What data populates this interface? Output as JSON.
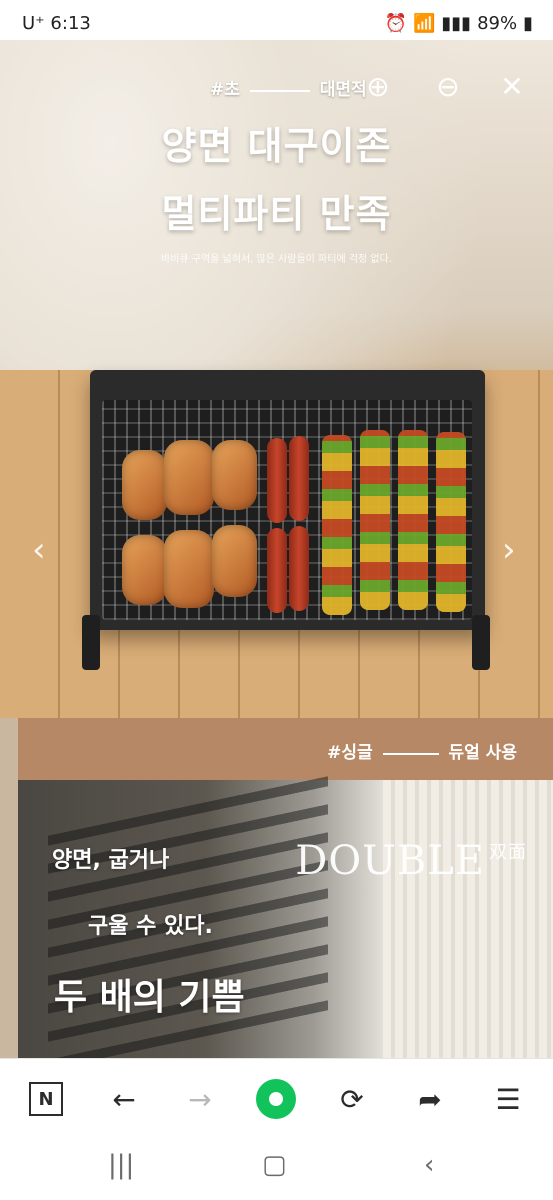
{
  "status_bar": {
    "time": "6:13",
    "carrier": "U⁺",
    "battery": "89%"
  },
  "viewer": {
    "buttons": {
      "zoom_in": "zoom-in-icon",
      "zoom_out": "zoom-out-icon",
      "close": "close-icon"
    },
    "nav_arrows": {
      "prev": "chevron-left-icon",
      "next": "chevron-right-icon"
    },
    "section1": {
      "hashtag_prefix": "#초",
      "hashtag_suffix": "대면적",
      "title_line1": "양면 대구이존",
      "title_line2": "멀티파티 만족",
      "subtitle": "바비큐 구역을 넓혀서, 많은 사람들이 파티에 걱정 없다."
    },
    "section2": {
      "hashtag_prefix": "#싱글",
      "hashtag_suffix": "듀얼 사용",
      "brand": "DOUBLE",
      "brand_cjk": "双面",
      "line1": "양면, 굽거나",
      "line2": "구울 수 있다.",
      "line3": "두 배의 기쁨"
    }
  },
  "browser_toolbar": {
    "items": [
      "N-logo-icon",
      "back-icon",
      "forward-icon",
      "home-green-icon",
      "refresh-icon",
      "share-icon",
      "menu-icon"
    ]
  },
  "system_nav": {
    "items": [
      "recent-apps-icon",
      "home-icon",
      "back-icon"
    ]
  },
  "colors": {
    "band": "#b78865",
    "green": "#12c35c"
  }
}
